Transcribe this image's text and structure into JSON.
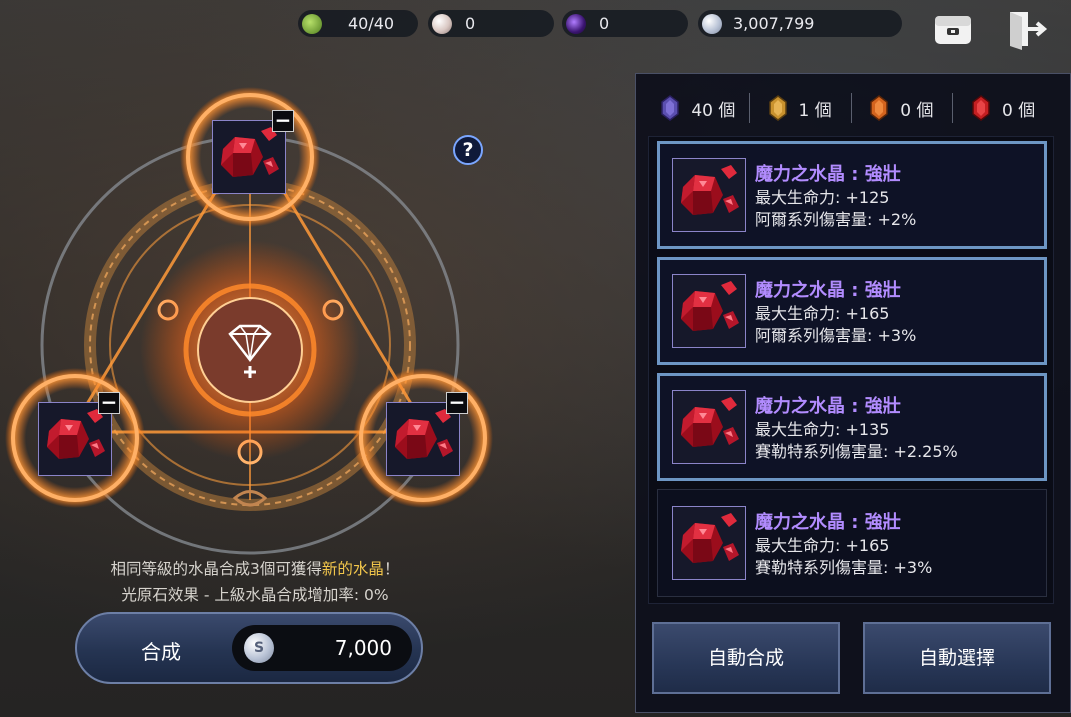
{
  "top_bar": {
    "stamina": {
      "value": "40/40",
      "icon": "green-stamina-icon"
    },
    "pearl": {
      "value": "0",
      "icon": "pearl-icon"
    },
    "dark_orb": {
      "value": "0",
      "icon": "purple-orb-icon"
    },
    "silver": {
      "value": "3,007,799",
      "icon": "silver-coin-icon"
    },
    "inventory_icon": "inventory-bag-icon",
    "exit_icon": "exit-door-icon"
  },
  "craft": {
    "help_label": "?",
    "remove_label": "−",
    "slots_filled": 3,
    "info_line1_a": "相同等級的水晶合成3個可獲得",
    "info_line1_hl": "新的水晶",
    "info_line1_b": "！",
    "info_line2": "光原石效果 - 上級水晶合成增加率: 0%",
    "combine_label": "合成",
    "combine_cost": "7,000",
    "coin_letter": "S"
  },
  "panel": {
    "counts": [
      {
        "value": "40 個",
        "color": "#5b4fb0"
      },
      {
        "value": "1 個",
        "color": "#c9922e"
      },
      {
        "value": "0 個",
        "color": "#d4641e"
      },
      {
        "value": "0 個",
        "color": "#c41f22"
      }
    ],
    "crystals": [
      {
        "name": "魔力之水晶 : 強壯",
        "stat1": "最大生命力: +125",
        "stat2": "阿爾系列傷害量: +2%",
        "selected": true
      },
      {
        "name": "魔力之水晶 : 強壯",
        "stat1": "最大生命力: +165",
        "stat2": "阿爾系列傷害量: +3%",
        "selected": true
      },
      {
        "name": "魔力之水晶 : 強壯",
        "stat1": "最大生命力: +135",
        "stat2": "賽勒特系列傷害量: +2.25%",
        "selected": true
      },
      {
        "name": "魔力之水晶 : 強壯",
        "stat1": "最大生命力: +165",
        "stat2": "賽勒特系列傷害量: +3%",
        "selected": false
      }
    ],
    "auto_combine_label": "自動合成",
    "auto_select_label": "自動選擇"
  },
  "colors": {
    "accent_gold": "#f2c64b",
    "crystal_name": "#b28cff",
    "selected_border": "#6d96c4",
    "fire_orange": "#ff8a2a"
  }
}
